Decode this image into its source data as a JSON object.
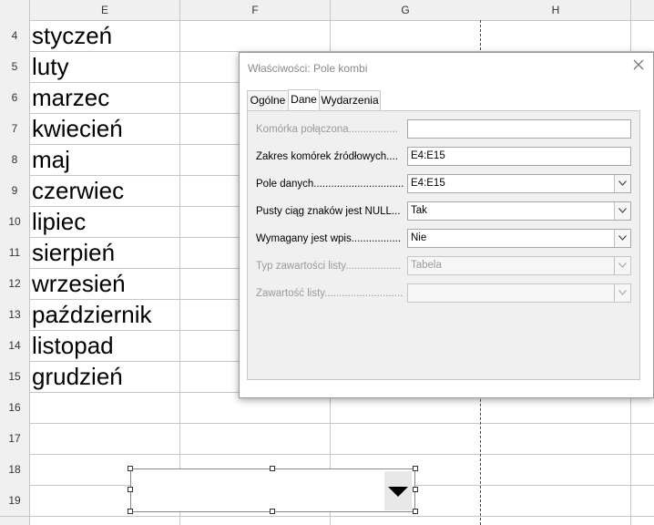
{
  "sheet": {
    "columns": [
      "E",
      "F",
      "G",
      "H"
    ],
    "rows": [
      "4",
      "5",
      "6",
      "7",
      "8",
      "9",
      "10",
      "11",
      "12",
      "13",
      "14",
      "15",
      "16",
      "17",
      "18",
      "19"
    ],
    "cells": [
      "styczeń",
      "luty",
      "marzec",
      "kwiecień",
      "maj",
      "czerwiec",
      "lipiec",
      "sierpień",
      "wrzesień",
      "październik",
      "listopad",
      "grudzień"
    ]
  },
  "dialog": {
    "title": "Właściwości: Pole kombi",
    "tabs": [
      "Ogólne",
      "Dane",
      "Wydarzenia"
    ],
    "active_tab": "Dane",
    "rows": [
      {
        "label": "Komórka połączona.................",
        "value": "",
        "type": "text",
        "disabled": true
      },
      {
        "label": "Zakres komórek źródłowych....",
        "value": "E4:E15",
        "type": "text",
        "disabled": false
      },
      {
        "label": "Pole danych...............................",
        "value": "E4:E15",
        "type": "dropdown",
        "disabled": false
      },
      {
        "label": "Pusty ciąg znaków jest NULL...",
        "value": "Tak",
        "type": "dropdown",
        "disabled": false
      },
      {
        "label": "Wymagany jest wpis.................",
        "value": "Nie",
        "type": "dropdown",
        "disabled": false
      },
      {
        "label": "Typ zawartości listy...................",
        "value": "Tabela",
        "type": "dropdown",
        "disabled": true
      },
      {
        "label": "Zawartość listy...........................",
        "value": "",
        "type": "dropdown",
        "disabled": true
      }
    ]
  },
  "icons": {
    "close": "close-icon",
    "dropdown": "chevron-down-icon",
    "combo_arrow": "triangle-down-icon"
  },
  "colors": {
    "grid": "#c6c6c6",
    "header_bg": "#f0f0f0",
    "disabled_text": "#9a9a9a"
  }
}
